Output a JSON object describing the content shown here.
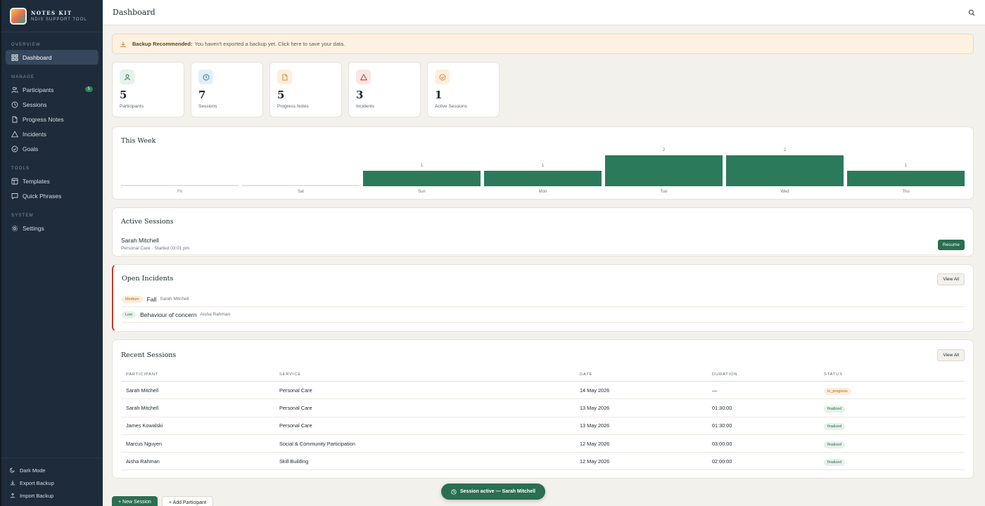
{
  "brand": {
    "name": "NOTES KIT",
    "tagline": "NDIS SUPPORT TOOL"
  },
  "sidebar": {
    "sections": [
      {
        "label": "OVERVIEW"
      },
      {
        "label": "MANAGE"
      },
      {
        "label": "TOOLS"
      },
      {
        "label": "SYSTEM"
      }
    ],
    "items": [
      {
        "label": "Dashboard",
        "icon": "grid-icon",
        "active": true
      },
      {
        "label": "Participants",
        "icon": "users-icon",
        "badge": "5"
      },
      {
        "label": "Sessions",
        "icon": "clock-icon"
      },
      {
        "label": "Progress Notes",
        "icon": "document-icon"
      },
      {
        "label": "Incidents",
        "icon": "warning-icon"
      },
      {
        "label": "Goals",
        "icon": "check-circle-icon"
      },
      {
        "label": "Templates",
        "icon": "template-icon"
      },
      {
        "label": "Quick Phrases",
        "icon": "chat-icon"
      },
      {
        "label": "Settings",
        "icon": "gear-icon"
      }
    ],
    "bottom": [
      {
        "label": "Dark Mode",
        "icon": "moon-icon"
      },
      {
        "label": "Export Backup",
        "icon": "download-icon"
      },
      {
        "label": "Import Backup",
        "icon": "upload-icon"
      }
    ]
  },
  "header": {
    "title": "Dashboard",
    "search_icon": "search-icon"
  },
  "alert": {
    "title": "Backup Recommended:",
    "message": "You haven't exported a backup yet. Click here to save your data."
  },
  "stats": [
    {
      "value": "5",
      "label": "Participants",
      "icon": "user-icon",
      "color": "#2e7d5b",
      "bg": "#e5f1e9"
    },
    {
      "value": "7",
      "label": "Sessions",
      "icon": "clock-icon",
      "color": "#2a7ab0",
      "bg": "#e3eff8"
    },
    {
      "value": "5",
      "label": "Progress Notes",
      "icon": "document-icon",
      "color": "#d98a2b",
      "bg": "#fdeede"
    },
    {
      "value": "3",
      "label": "Incidents",
      "icon": "warning-icon",
      "color": "#c0392b",
      "bg": "#fbe6e3"
    },
    {
      "value": "1",
      "label": "Active Sessions",
      "icon": "check-circle-icon",
      "color": "#d98a2b",
      "bg": "#fdeede"
    }
  ],
  "chart_data": {
    "type": "bar",
    "title": "This Week",
    "categories": [
      "Fri",
      "Sat",
      "Sun",
      "Mon",
      "Tue",
      "Wed",
      "Thu"
    ],
    "values": [
      0,
      0,
      1,
      1,
      2,
      2,
      1
    ],
    "ylim": [
      0,
      2
    ],
    "grid": false,
    "color": "#2b7a5c"
  },
  "active_sessions": {
    "title": "Active Sessions",
    "items": [
      {
        "name": "Sarah Mitchell",
        "detail": "Personal Care · Started 03:01 pm",
        "action": "Resume"
      }
    ]
  },
  "incidents": {
    "title": "Open Incidents",
    "view_all": "View All",
    "items": [
      {
        "severity": "Medium",
        "type": "Fall",
        "person": "Sarah Mitchell"
      },
      {
        "severity": "Low",
        "type": "Behaviour of concern",
        "person": "Aisha Rahman"
      }
    ]
  },
  "recent_sessions": {
    "title": "Recent Sessions",
    "view_all": "View All",
    "columns": [
      "PARTICIPANT",
      "SERVICE",
      "DATE",
      "DURATION",
      "STATUS"
    ],
    "rows": [
      [
        "Sarah Mitchell",
        "Personal Care",
        "14 May 2026",
        "—",
        "in_progress"
      ],
      [
        "Sarah Mitchell",
        "Personal Care",
        "13 May 2026",
        "01:30:00",
        "finalized"
      ],
      [
        "James Kowalski",
        "Personal Care",
        "13 May 2026",
        "01:30:00",
        "finalized"
      ],
      [
        "Marcus Nguyen",
        "Social & Community Participation",
        "12 May 2026",
        "03:00:00",
        "finalized"
      ],
      [
        "Aisha Rahman",
        "Skill Building",
        "12 May 2026",
        "02:00:00",
        "finalized"
      ]
    ]
  },
  "footer_actions": {
    "new_session": "+ New Session",
    "add_participant": "+ Add Participant"
  },
  "toast": {
    "text": "Session active — Sarah Mitchell"
  }
}
